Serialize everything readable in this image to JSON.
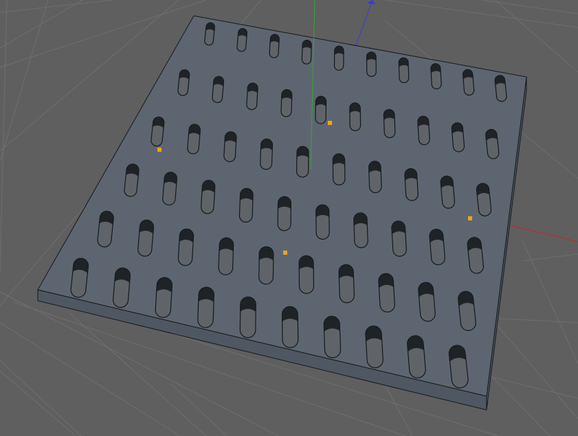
{
  "viewport": {
    "background_color": "#5f5f5f",
    "grid_color": "#6f6f6f",
    "axis_x_color": "#c2292a",
    "axis_y_color": "#39a63a",
    "axis_z_color": "#3a3ad6"
  },
  "object": {
    "name": "perforated-plate",
    "top_color": "#5d6670",
    "side_color": "#4f5862",
    "hole_fill_color": "#606469",
    "hole_shadow_color": "#1b1d20",
    "edge_color": "#14171a",
    "rows": 6,
    "columns": 10
  },
  "selection": {
    "handle_color": "#f3a21e",
    "handle_count": 4
  }
}
